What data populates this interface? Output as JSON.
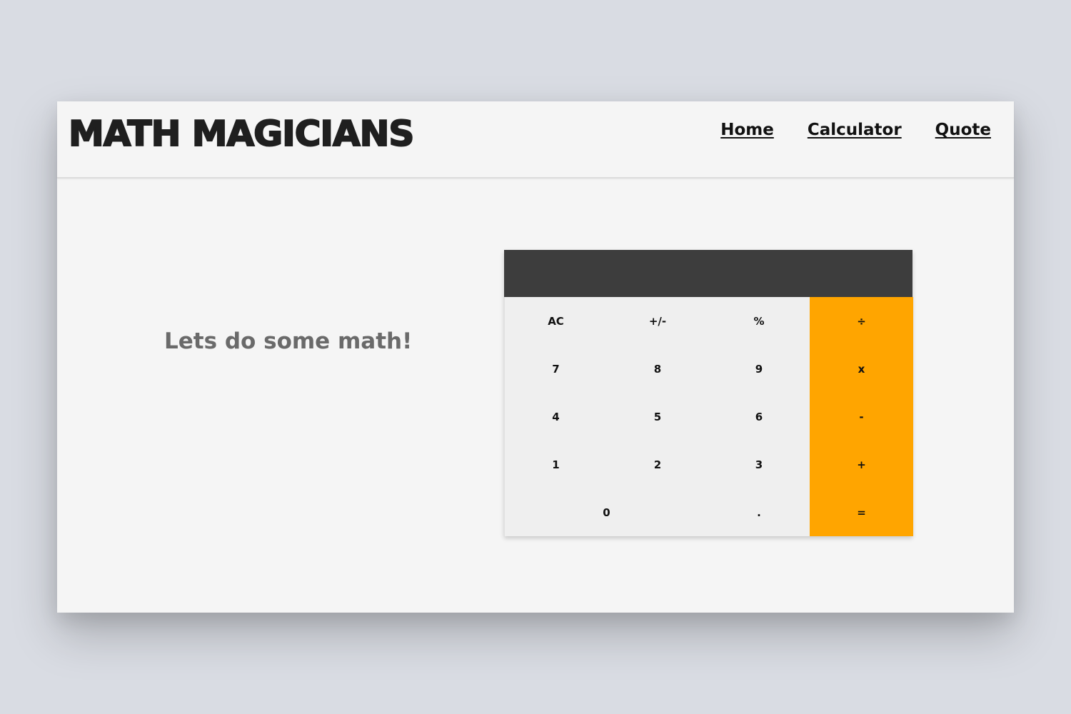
{
  "app": {
    "title": "MATH MAGICIANS"
  },
  "nav": {
    "items": [
      {
        "label": "Home"
      },
      {
        "label": "Calculator"
      },
      {
        "label": "Quote"
      }
    ]
  },
  "main": {
    "tagline": "Lets do some math!"
  },
  "calculator": {
    "display": "",
    "keys": [
      {
        "label": "AC",
        "type": "function"
      },
      {
        "label": "+/-",
        "type": "function"
      },
      {
        "label": "%",
        "type": "function"
      },
      {
        "label": "÷",
        "type": "operator"
      },
      {
        "label": "7",
        "type": "digit"
      },
      {
        "label": "8",
        "type": "digit"
      },
      {
        "label": "9",
        "type": "digit"
      },
      {
        "label": "x",
        "type": "operator"
      },
      {
        "label": "4",
        "type": "digit"
      },
      {
        "label": "5",
        "type": "digit"
      },
      {
        "label": "6",
        "type": "digit"
      },
      {
        "label": "-",
        "type": "operator"
      },
      {
        "label": "1",
        "type": "digit"
      },
      {
        "label": "2",
        "type": "digit"
      },
      {
        "label": "3",
        "type": "digit"
      },
      {
        "label": "+",
        "type": "operator"
      },
      {
        "label": "0",
        "type": "digit"
      },
      {
        "label": ".",
        "type": "digit"
      },
      {
        "label": "=",
        "type": "operator"
      }
    ]
  },
  "colors": {
    "accent": "#ffa500",
    "display_bg": "#3d3d3d",
    "keypad_bg": "#efefef",
    "page_bg": "#f5f5f5"
  }
}
